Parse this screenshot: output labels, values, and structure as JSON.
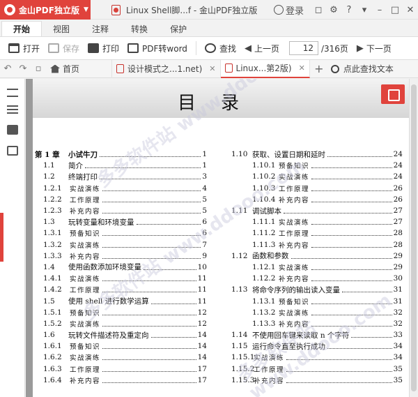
{
  "app": {
    "name": "金山PDF独立版",
    "window_title": "Linux Shell脚...f - 金山PDF独立版",
    "login": "登录"
  },
  "menu": [
    "开始",
    "视图",
    "注释",
    "转换",
    "保护"
  ],
  "toolbar": {
    "open": "打开",
    "save": "保存",
    "print": "打印",
    "pdf2word": "PDF转word",
    "find": "查找",
    "prev": "上一页",
    "page": "12",
    "total": "/316页",
    "next": "下一页"
  },
  "tabs": [
    {
      "label": "首页"
    },
    {
      "label": "设计模式之...1.net)"
    },
    {
      "label": "Linux...第2版)"
    }
  ],
  "hint": "点此查找文本",
  "page_title": "目录",
  "watermark": "多多软件站 www.ddooo.com",
  "toc_left": [
    {
      "n": "第 1 章",
      "t": "小试牛刀",
      "p": "1",
      "lv": 0
    },
    {
      "n": "1.1",
      "t": "简介",
      "p": "1",
      "lv": 1
    },
    {
      "n": "1.2",
      "t": "终端打印",
      "p": "3",
      "lv": 1
    },
    {
      "n": "1.2.1",
      "t": "实战演练",
      "p": "4",
      "lv": 2
    },
    {
      "n": "1.2.2",
      "t": "工作原理",
      "p": "5",
      "lv": 2
    },
    {
      "n": "1.2.3",
      "t": "补充内容",
      "p": "5",
      "lv": 2
    },
    {
      "n": "1.3",
      "t": "玩转变量和环境变量",
      "p": "6",
      "lv": 1
    },
    {
      "n": "1.3.1",
      "t": "预备知识",
      "p": "6",
      "lv": 2
    },
    {
      "n": "1.3.2",
      "t": "实战演练",
      "p": "7",
      "lv": 2
    },
    {
      "n": "1.3.3",
      "t": "补充内容",
      "p": "9",
      "lv": 2
    },
    {
      "n": "1.4",
      "t": "使用函数添加环境变量",
      "p": "10",
      "lv": 1
    },
    {
      "n": "1.4.1",
      "t": "实战演练",
      "p": "11",
      "lv": 2
    },
    {
      "n": "1.4.2",
      "t": "工作原理",
      "p": "11",
      "lv": 2
    },
    {
      "n": "1.5",
      "t": "使用 shell 进行数学运算",
      "p": "11",
      "lv": 1
    },
    {
      "n": "1.5.1",
      "t": "预备知识",
      "p": "12",
      "lv": 2
    },
    {
      "n": "1.5.2",
      "t": "实战演练",
      "p": "12",
      "lv": 2
    },
    {
      "n": "1.6",
      "t": "玩转文件描述符及重定向",
      "p": "14",
      "lv": 1
    },
    {
      "n": "1.6.1",
      "t": "预备知识",
      "p": "14",
      "lv": 2
    },
    {
      "n": "1.6.2",
      "t": "实战演练",
      "p": "14",
      "lv": 2
    },
    {
      "n": "1.6.3",
      "t": "工作原理",
      "p": "17",
      "lv": 2
    },
    {
      "n": "1.6.4",
      "t": "补充内容",
      "p": "17",
      "lv": 2
    }
  ],
  "toc_right": [
    {
      "n": "1.10",
      "t": "获取、设置日期和延时",
      "p": "24",
      "lv": 1
    },
    {
      "n": "1.10.1",
      "t": "预备知识",
      "p": "24",
      "lv": 2
    },
    {
      "n": "1.10.2",
      "t": "实战演练",
      "p": "24",
      "lv": 2
    },
    {
      "n": "1.10.3",
      "t": "工作原理",
      "p": "26",
      "lv": 2
    },
    {
      "n": "1.10.4",
      "t": "补充内容",
      "p": "26",
      "lv": 2
    },
    {
      "n": "1.11",
      "t": "调试脚本",
      "p": "27",
      "lv": 1
    },
    {
      "n": "1.11.1",
      "t": "实战演练",
      "p": "27",
      "lv": 2
    },
    {
      "n": "1.11.2",
      "t": "工作原理",
      "p": "28",
      "lv": 2
    },
    {
      "n": "1.11.3",
      "t": "补充内容",
      "p": "28",
      "lv": 2
    },
    {
      "n": "1.12",
      "t": "函数和参数",
      "p": "29",
      "lv": 1
    },
    {
      "n": "1.12.1",
      "t": "实战演练",
      "p": "29",
      "lv": 2
    },
    {
      "n": "1.12.2",
      "t": "补充内容",
      "p": "30",
      "lv": 2
    },
    {
      "n": "1.13",
      "t": "将命令序列的输出读入变量",
      "p": "31",
      "lv": 1
    },
    {
      "n": "1.13.1",
      "t": "预备知识",
      "p": "31",
      "lv": 2
    },
    {
      "n": "1.13.2",
      "t": "实战演练",
      "p": "32",
      "lv": 2
    },
    {
      "n": "1.13.3",
      "t": "补充内容",
      "p": "32",
      "lv": 2
    },
    {
      "n": "1.14",
      "t": "不使用回车键来读取 n 个字符",
      "p": "33",
      "lv": 1
    },
    {
      "n": "1.15",
      "t": "运行命令直至执行成功",
      "p": "34",
      "lv": 1
    },
    {
      "n": "1.15.1",
      "t": "实战演练",
      "p": "34",
      "lv": 3
    },
    {
      "n": "1.15.2",
      "t": "工作原理",
      "p": "35",
      "lv": 3
    },
    {
      "n": "1.15.3",
      "t": "补充内容",
      "p": "35",
      "lv": 3
    }
  ]
}
